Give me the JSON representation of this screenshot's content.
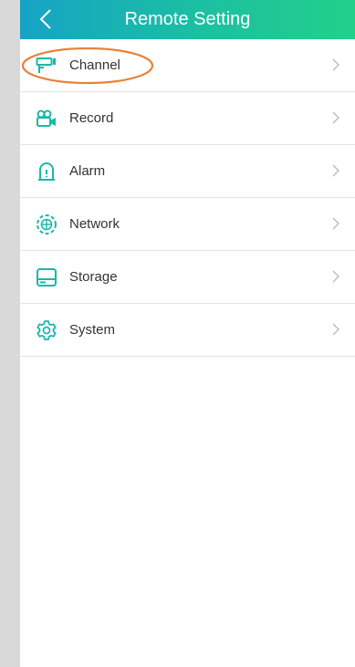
{
  "header": {
    "title": "Remote Setting",
    "back_icon": "chevron-left-icon"
  },
  "menu": {
    "items": [
      {
        "label": "Channel",
        "icon": "camera-icon"
      },
      {
        "label": "Record",
        "icon": "video-record-icon"
      },
      {
        "label": "Alarm",
        "icon": "alarm-siren-icon"
      },
      {
        "label": "Network",
        "icon": "network-globe-icon"
      },
      {
        "label": "Storage",
        "icon": "hard-drive-icon"
      },
      {
        "label": "System",
        "icon": "gear-icon"
      }
    ]
  },
  "colors": {
    "accent": "#1cb8a8",
    "header_start": "#16a3c7",
    "header_end": "#22d08a",
    "annotation": "#e8823a",
    "chevron": "#b8b8b8"
  }
}
